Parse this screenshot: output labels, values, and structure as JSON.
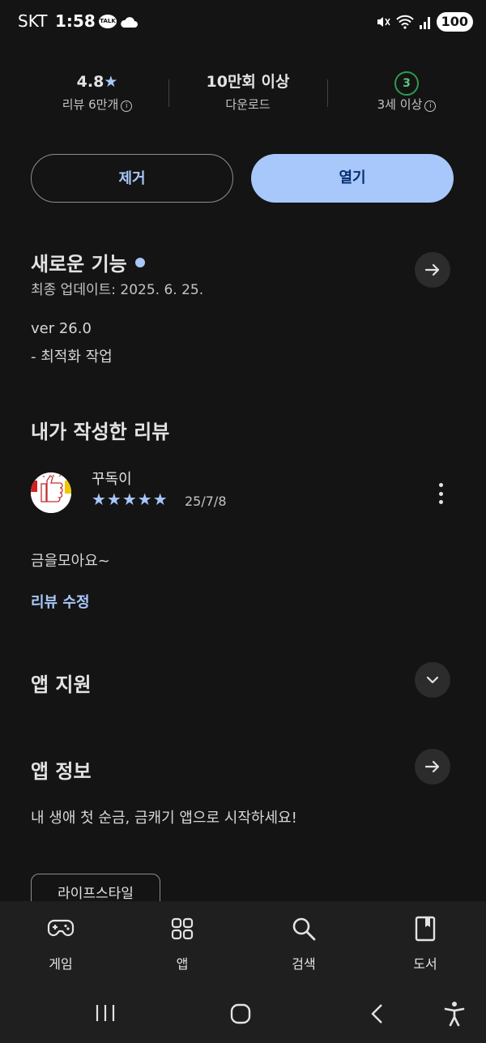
{
  "status_bar": {
    "carrier": "SKT",
    "time": "1:58",
    "talk_badge": "TALK",
    "battery": "100",
    "icons": [
      "kakaotalk-icon",
      "cloud-icon",
      "mute-icon",
      "wifi-icon",
      "signal-icon",
      "battery-icon"
    ]
  },
  "stats": {
    "rating": {
      "value": "4.8",
      "star": "★",
      "label": "리뷰 6만개",
      "info": "i"
    },
    "downloads": {
      "value": "10만회 이상",
      "label": "다운로드"
    },
    "age": {
      "badge": "3",
      "label": "3세 이상",
      "info": "i"
    }
  },
  "actions": {
    "remove_label": "제거",
    "open_label": "열기"
  },
  "whats_new": {
    "title": "새로운 기능",
    "updated": "최종 업데이트: 2025. 6. 25.",
    "version": "ver 26.0",
    "notes": "- 최적화 작업"
  },
  "my_review": {
    "title": "내가 작성한 리뷰",
    "author": "꾸독이",
    "stars": "★★★★★",
    "rating": 5,
    "date": "25/7/8",
    "text": "금을모아요~",
    "edit_label": "리뷰 수정"
  },
  "app_support": {
    "title": "앱 지원"
  },
  "about": {
    "title": "앱 정보",
    "description": "내 생애 첫 순금, 금캐기 앱으로 시작하세요!",
    "category_chip": "라이프스타일"
  },
  "bottom_nav": [
    {
      "label": "게임",
      "icon": "gamepad-icon"
    },
    {
      "label": "앱",
      "icon": "apps-grid-icon"
    },
    {
      "label": "검색",
      "icon": "search-icon"
    },
    {
      "label": "도서",
      "icon": "book-icon"
    }
  ],
  "colors": {
    "accent": "#a8c7fa",
    "background": "#141414",
    "age_green": "#2e9a4f"
  }
}
